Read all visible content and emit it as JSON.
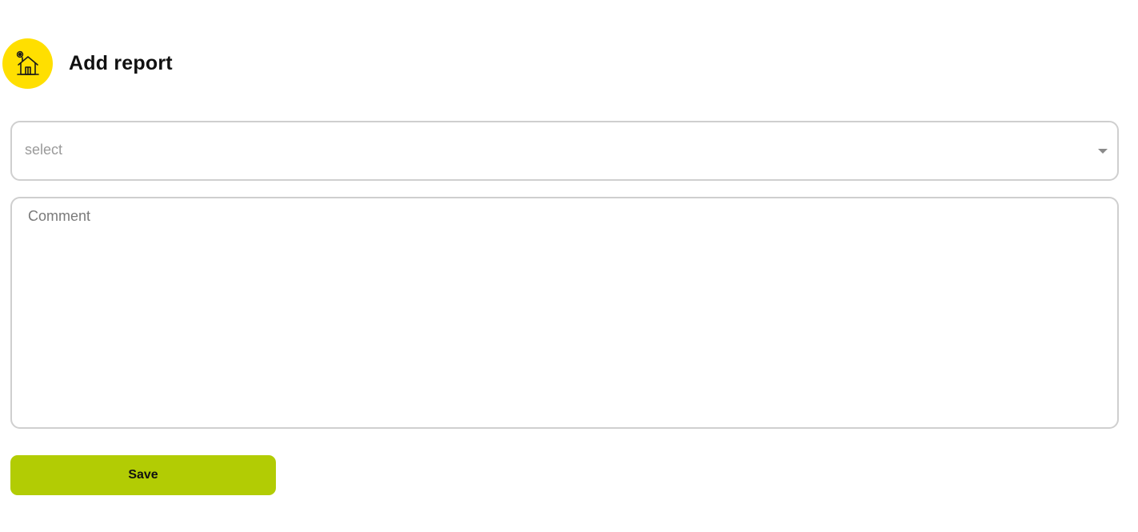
{
  "header": {
    "title": "Add report",
    "icon": "house-gear-icon",
    "icon_bg_color": "#ffdf00"
  },
  "form": {
    "select": {
      "placeholder": "select",
      "caret_icon": "caret-down-icon"
    },
    "comment": {
      "placeholder": "Comment",
      "value": ""
    },
    "save_label": "Save",
    "save_color": "#b2cc04"
  }
}
